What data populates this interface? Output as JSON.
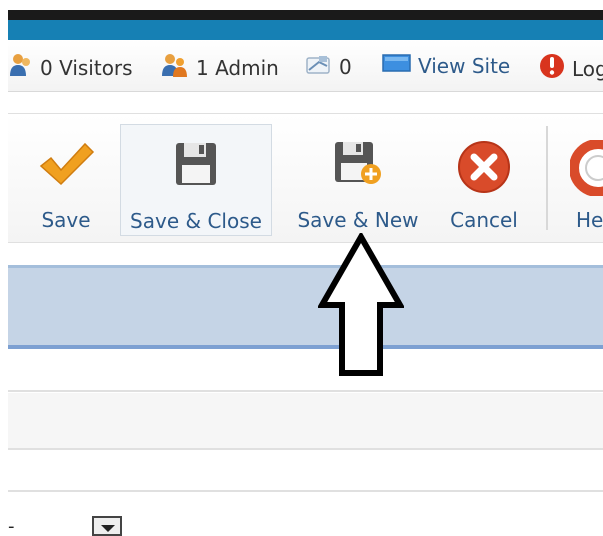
{
  "status": {
    "visitors": "0 Visitors",
    "admin": "1 Admin",
    "messages": "0",
    "view_site": "View Site",
    "logout": "Log"
  },
  "toolbar": {
    "save": "Save",
    "save_close": "Save & Close",
    "save_new": "Save & New",
    "cancel": "Cancel",
    "help": "He"
  },
  "form": {
    "select_value": "-"
  },
  "colors": {
    "header_blue": "#1680b4",
    "band_blue": "#c5d4e6",
    "link_blue": "#2d5a8a",
    "save_orange": "#f0a020",
    "cancel_red": "#d94b2a"
  },
  "icons": [
    "users-icon",
    "admin-icon",
    "message-icon",
    "monitor-icon",
    "logout-icon",
    "checkmark-icon",
    "floppy-disk-icon",
    "floppy-add-icon",
    "cancel-x-icon",
    "help-lifebuoy-icon"
  ]
}
